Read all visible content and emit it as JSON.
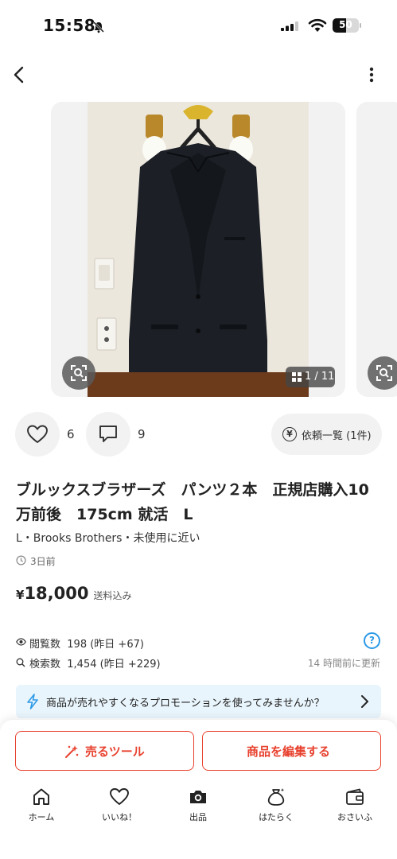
{
  "status_bar": {
    "time": "15:58",
    "battery": "50",
    "battery_level": 0.5
  },
  "carousel": {
    "counter": "1 / 11"
  },
  "reactions": {
    "likes": "6",
    "comments": "9",
    "request_label": "依頼一覧 (1件)",
    "yen_symbol": "¥"
  },
  "item": {
    "title": "ブルックスブラザーズ　パンツ２本　正規店購入10万前後　175cm 就活　L",
    "attributes": "L・Brooks Brothers・未使用に近い",
    "posted": "3日前",
    "price_symbol": "¥",
    "price": "18,000",
    "shipping": "送料込み"
  },
  "stats": {
    "views_label": "閲覧数",
    "views_value": "198 (昨日 +67)",
    "search_label": "検索数",
    "search_value": "1,454 (昨日 +229)",
    "updated": "14 時間前に更新",
    "help_symbol": "?"
  },
  "promo": {
    "text": "商品が売れやすくなるプロモーションを使ってみませんか？"
  },
  "actions": {
    "sell_tool": "売るツール",
    "edit_item": "商品を編集する"
  },
  "tabbar": [
    {
      "label": "ホーム",
      "icon": "home-icon"
    },
    {
      "label": "いいね！",
      "icon": "heart-icon"
    },
    {
      "label": "出品",
      "icon": "camera-icon"
    },
    {
      "label": "はたらく",
      "icon": "money-bag-icon"
    },
    {
      "label": "おさいふ",
      "icon": "wallet-icon"
    }
  ],
  "colors": {
    "accent": "#e8412e",
    "info": "#2c9ae6",
    "promo_bg": "#e9f5fc"
  }
}
